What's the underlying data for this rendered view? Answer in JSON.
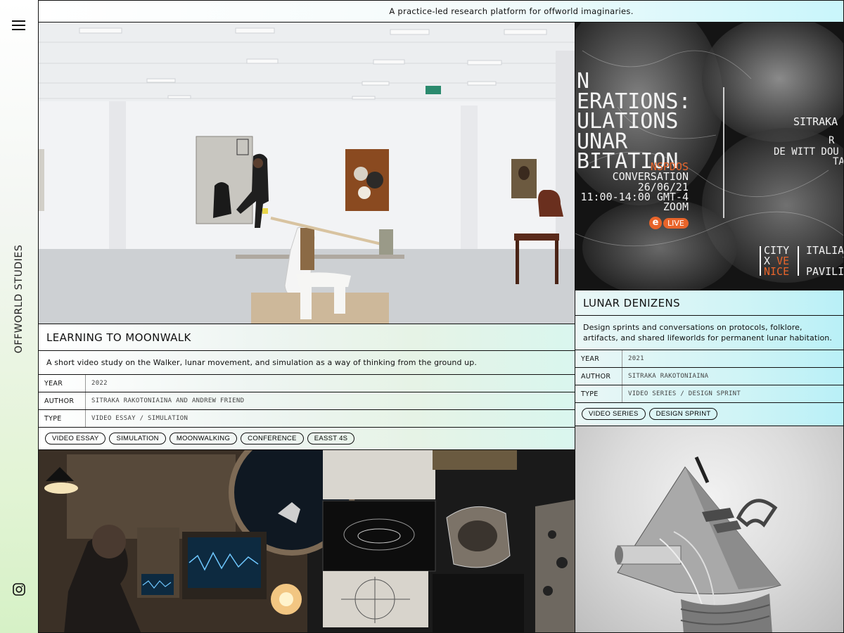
{
  "banner": {
    "text": "A practice-led research platform for offworld imaginaries."
  },
  "sidebar": {
    "title": "OFFWORLD STUDIES",
    "menu_icon": "hamburger-icon",
    "social_icon": "instagram-icon"
  },
  "projects": [
    {
      "title": "LEARNING TO MOONWALK",
      "description": "A short video study on the Walker, lunar movement, and simulation as a way of thinking from the ground up.",
      "meta": [
        {
          "key": "YEAR",
          "value": "2022"
        },
        {
          "key": "AUTHOR",
          "value": "SITRAKA RAKOTONIAINA AND ANDREW FRIEND"
        },
        {
          "key": "TYPE",
          "value": "VIDEO ESSAY / SIMULATION"
        }
      ],
      "tags": [
        "VIDEO ESSAY",
        "SIMULATION",
        "MOONWALKING",
        "CONFERENCE",
        "EASST 4S"
      ]
    },
    {
      "title": "LUNAR DENIZENS",
      "description": "Design sprints and conversations on protocols, folklore, artifacts, and shared lifeworlds for permanent lunar habitation.",
      "meta": [
        {
          "key": "YEAR",
          "value": "2021"
        },
        {
          "key": "AUTHOR",
          "value": "SITRAKA RAKOTONIAINA"
        },
        {
          "key": "TYPE",
          "value": "VIDEO SERIES / DESIGN SPRINT"
        }
      ],
      "tags": [
        "VIDEO SERIES",
        "DESIGN SPRINT"
      ]
    }
  ],
  "poster": {
    "lines": [
      "N",
      "ERATIONS:",
      "ULATIONS",
      "UNAR",
      "BITATION"
    ],
    "accent": "NSPDOS",
    "info": [
      "CONVERSATION",
      "26/06/21",
      "11:00-14:00 GMT-4",
      "ZOOM"
    ],
    "live_badge": "LIVE",
    "right_names": [
      "SITRAKA",
      "R",
      "DE WITT DOU",
      "TA"
    ],
    "city": "CITY",
    "x": "X",
    "ve": "VE",
    "nice": "NICE",
    "italia": "ITALIA",
    "v": "V",
    "pavilion": "PAVILIO"
  },
  "colors": {
    "accent_orange": "#e8642a",
    "border": "#111111"
  }
}
